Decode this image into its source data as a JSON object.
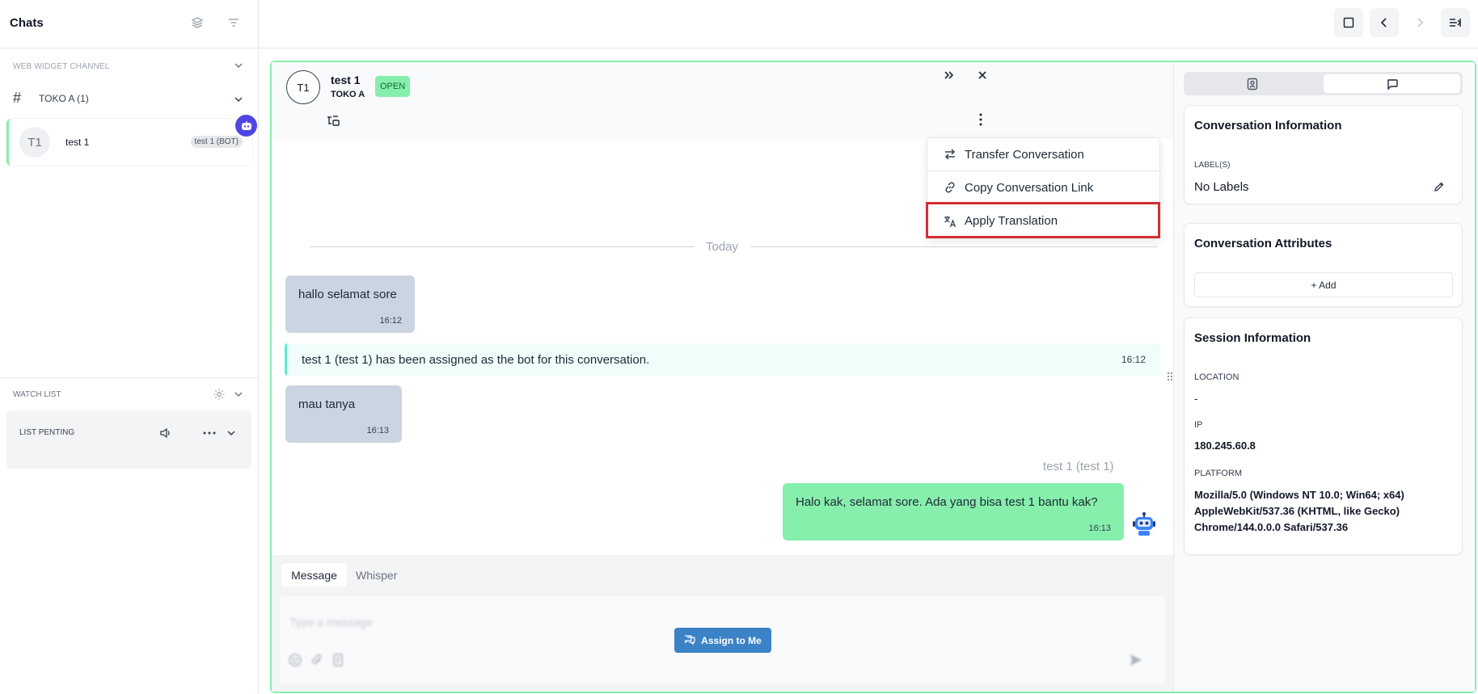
{
  "sidebar": {
    "title": "Chats",
    "channel_label": "WEB WIDGET CHANNEL",
    "group_name": "TOKO A (1)",
    "chat_item": {
      "avatar": "T1",
      "name": "test 1",
      "tag": "test 1 (BOT)"
    },
    "watch_label": "WATCH LIST",
    "watch_item_label": "LIST PENTING"
  },
  "conversation": {
    "avatar": "T1",
    "name": "test 1",
    "subtitle": "TOKO A",
    "status": "OPEN",
    "day_separator": "Today",
    "messages": [
      {
        "text": "hallo selamat sore",
        "time": "16:12"
      },
      {
        "text": "mau tanya",
        "time": "16:13"
      }
    ],
    "system_message": {
      "text": "test 1 (test 1) has been assigned as the bot for this conversation.",
      "time": "16:12"
    },
    "outgoing": {
      "sender": "test 1 (test 1)",
      "text": "Halo kak, selamat sore. Ada yang bisa test 1 bantu kak?",
      "time": "16:13"
    }
  },
  "dropdown": {
    "items": [
      {
        "label": "Transfer Conversation",
        "icon": "transfer-icon"
      },
      {
        "label": "Copy Conversation Link",
        "icon": "link-icon"
      },
      {
        "label": "Apply Translation",
        "icon": "translate-icon"
      }
    ]
  },
  "composer": {
    "tab_message": "Message",
    "tab_whisper": "Whisper",
    "placeholder": "Type a message",
    "assign_label": "Assign to Me"
  },
  "right_panel": {
    "conversation_info": {
      "title": "Conversation Information",
      "labels_heading": "LABEL(S)",
      "labels_value": "No Labels"
    },
    "attributes": {
      "title": "Conversation Attributes",
      "add_label": "+ Add"
    },
    "session": {
      "title": "Session Information",
      "location_label": "LOCATION",
      "location_value": "-",
      "ip_label": "IP",
      "ip_value": "180.245.60.8",
      "platform_label": "PLATFORM",
      "platform_value": "Mozilla/5.0 (Windows NT 10.0; Win64; x64) AppleWebKit/537.36 (KHTML, like Gecko) Chrome/144.0.0.0 Safari/537.36"
    }
  },
  "colors": {
    "accent_green": "#86efac",
    "bot_badge": "#4f46e5",
    "assign_button": "#3b82c6",
    "highlight_red": "#d52d33"
  }
}
